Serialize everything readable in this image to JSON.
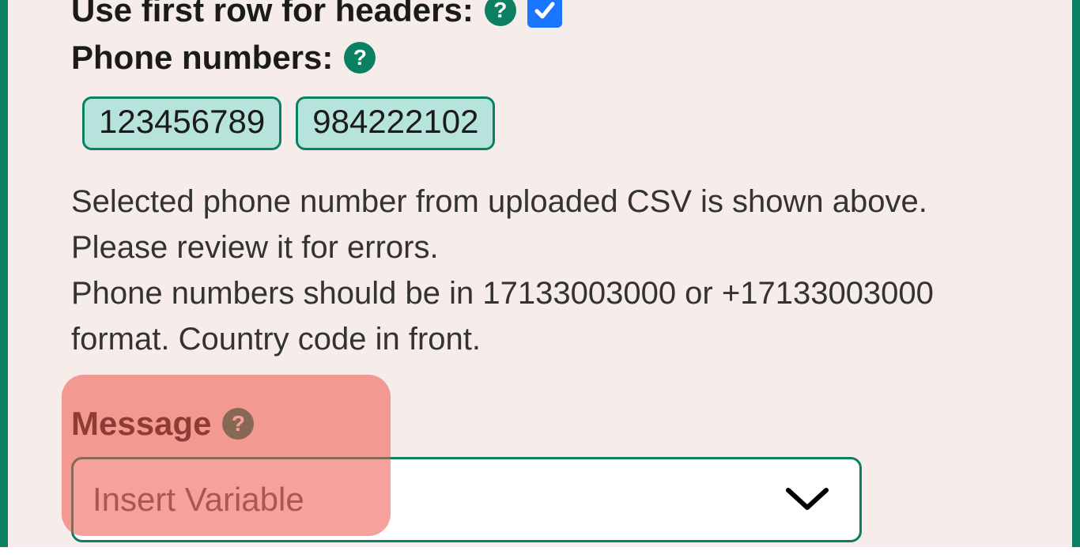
{
  "headers_row": {
    "label": "Use first row for headers:",
    "checked": true
  },
  "phone_numbers": {
    "label": "Phone numbers:",
    "chips": [
      "123456789",
      "984222102"
    ]
  },
  "instructions": {
    "line1": "Selected phone number from uploaded CSV is shown above. Please review it for errors.",
    "line2": "Phone numbers should be in 17133003000 or +17133003000 format. Country code in front."
  },
  "message": {
    "label": "Message",
    "dropdown_placeholder": "Insert Variable"
  }
}
